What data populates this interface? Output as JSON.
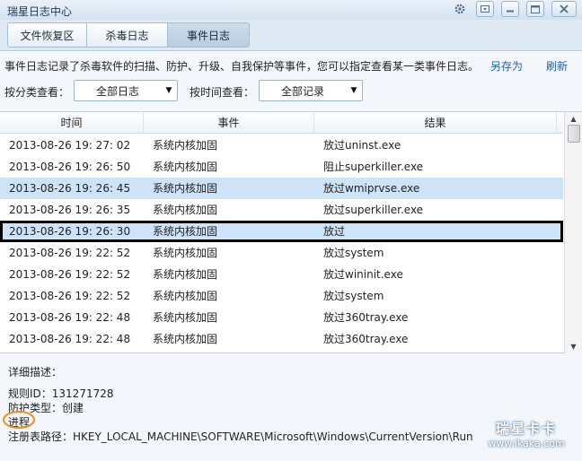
{
  "window": {
    "title": "瑞星日志中心"
  },
  "tabs": [
    {
      "label": "文件恢复区"
    },
    {
      "label": "杀毒日志"
    },
    {
      "label": "事件日志"
    }
  ],
  "intro": "事件日志记录了杀毒软件的扫描、防护、升级、自我保护等事件，您可以指定查看某一类事件日志。",
  "links": {
    "save_as": "另存为",
    "refresh": "刷新"
  },
  "filters": {
    "category_label": "按分类查看：",
    "category_value": "全部日志",
    "time_label": "按时间查看：",
    "time_value": "全部记录"
  },
  "table": {
    "columns": [
      "时间",
      "事件",
      "结果"
    ],
    "rows": [
      {
        "time": "2013-08-26 19: 27: 02",
        "event": "系统内核加固",
        "result": "放过uninst.exe",
        "state": "normal"
      },
      {
        "time": "2013-08-26 19: 26: 50",
        "event": "系统内核加固",
        "result": "阻止superkiller.exe",
        "state": "normal"
      },
      {
        "time": "2013-08-26 19: 26: 45",
        "event": "系统内核加固",
        "result": "放过wmiprvse.exe",
        "state": "selected"
      },
      {
        "time": "2013-08-26 19: 26: 35",
        "event": "系统内核加固",
        "result": "放过superkiller.exe",
        "state": "normal"
      },
      {
        "time": "2013-08-26 19: 26: 30",
        "event": "系统内核加固",
        "result": "放过",
        "state": "highlighted"
      },
      {
        "time": "2013-08-26 19: 22: 52",
        "event": "系统内核加固",
        "result": "放过system",
        "state": "normal"
      },
      {
        "time": "2013-08-26 19: 22: 52",
        "event": "系统内核加固",
        "result": "放过wininit.exe",
        "state": "normal"
      },
      {
        "time": "2013-08-26 19: 22: 52",
        "event": "系统内核加固",
        "result": "放过system",
        "state": "normal"
      },
      {
        "time": "2013-08-26 19: 22: 48",
        "event": "系统内核加固",
        "result": "放过360tray.exe",
        "state": "normal"
      },
      {
        "time": "2013-08-26 19: 22: 48",
        "event": "系统内核加固",
        "result": "放过360tray.exe",
        "state": "normal"
      }
    ]
  },
  "details": {
    "heading": "详细描述：",
    "rule_id": "规则ID：131271728",
    "defense_type": "防护类型：创建",
    "object": "进程",
    "registry_path": "注册表路径：HKEY_LOCAL_MACHINE\\SOFTWARE\\Microsoft\\Windows\\CurrentVersion\\Run"
  },
  "watermark": {
    "line1": "瑞星卡卡",
    "line2": "www.ikaka.com"
  },
  "icons": {
    "settings": "gear-icon",
    "menu": "dropdown-icon",
    "minimize": "minimize-icon",
    "maximize": "maximize-icon",
    "close": "close-icon"
  },
  "colors": {
    "link": "#1e63b7",
    "selected_row": "#cde3f7",
    "annotation_circle": "#f28c1a",
    "annotation_box": "#000000"
  }
}
